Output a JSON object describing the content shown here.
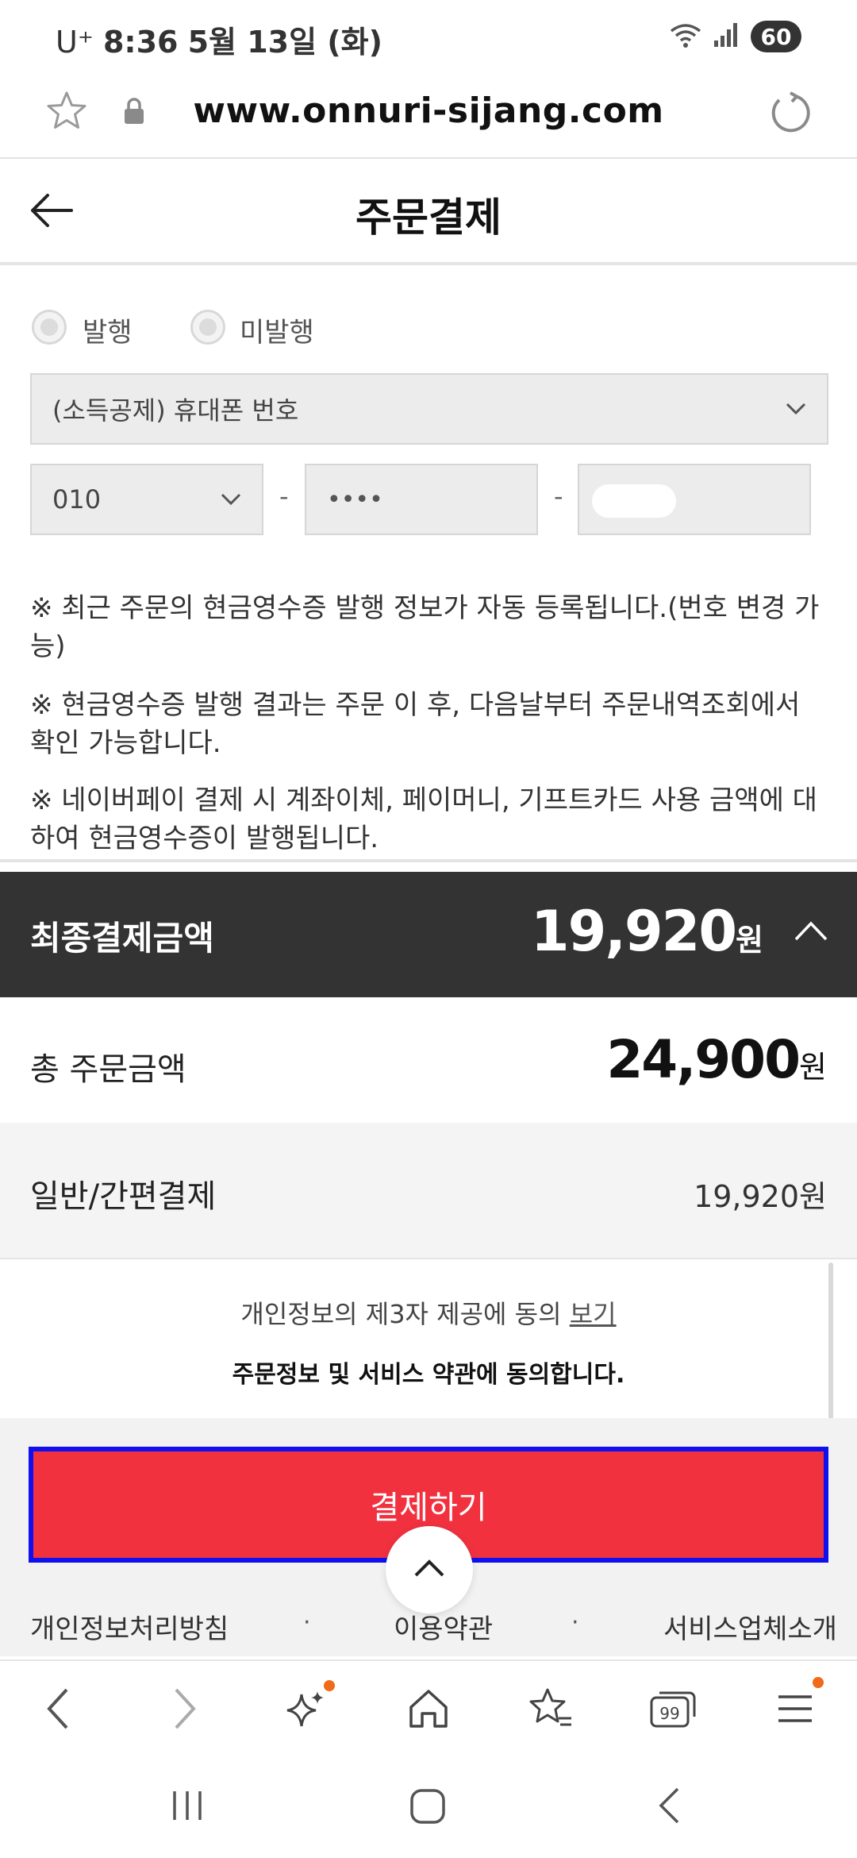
{
  "status": {
    "carrier": "U⁺",
    "time": "8:36",
    "date": "5월 13일 (화)",
    "battery": "60"
  },
  "browser": {
    "url": "www.onnuri-sijang.com"
  },
  "header": {
    "title": "주문결제"
  },
  "receipt": {
    "radio_issue": "발행",
    "radio_no_issue": "미발행",
    "type_select": "(소득공제) 휴대폰 번호",
    "phone_prefix": "010",
    "phone_middle": "••••",
    "separator": "-",
    "notes": [
      "※ 최근 주문의 현금영수증 발행 정보가 자동 등록됩니다.(번호 변경 가능)",
      "※ 현금영수증 발행 결과는 주문 이 후, 다음날부터 주문내역조회에서 확인 가능합니다.",
      "※ 네이버페이 결제 시 계좌이체, 페이머니, 기프트카드 사용 금액에 대하여 현금영수증이 발행됩니다."
    ]
  },
  "summary": {
    "final_label": "최종결제금액",
    "final_amount": "19,920",
    "total_label": "총 주문금액",
    "total_amount": "24,900",
    "pay_method_label": "일반/간편결제",
    "pay_method_amount": "19,920원",
    "unit": "원"
  },
  "agreement": {
    "privacy_text": "개인정보의 제3자 제공에 동의",
    "view_link": "보기",
    "terms_text": "주문정보 및 서비스 약관에 동의합니다."
  },
  "pay_button": "결제하기",
  "footer": {
    "links": [
      "개인정보처리방침",
      "이용약관",
      "서비스업체소개"
    ],
    "dot": "·"
  },
  "tabs_count": "99",
  "colors": {
    "pay_button": "#f2313f",
    "highlight_border": "#1010ee",
    "final_bar": "#333333",
    "badge": "#f06a1a"
  }
}
